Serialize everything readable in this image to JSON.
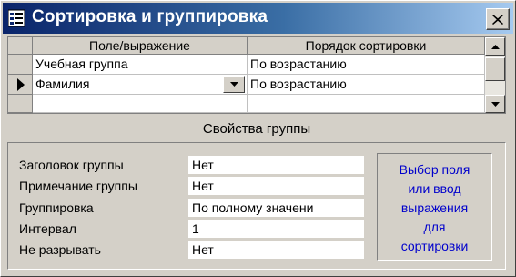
{
  "window": {
    "title": "Сортировка и группировка"
  },
  "grid": {
    "columns": [
      "Поле/выражение",
      "Порядок сортировки"
    ],
    "rows": [
      {
        "field": "Учебная группа",
        "order": "По возрастанию"
      },
      {
        "field": "Фамилия",
        "order": "По возрастанию"
      },
      {
        "field": "",
        "order": ""
      }
    ],
    "current_row": 1
  },
  "group_properties": {
    "title": "Свойства группы",
    "items": [
      {
        "label": "Заголовок группы",
        "value": "Нет"
      },
      {
        "label": "Примечание группы",
        "value": "Нет"
      },
      {
        "label": "Группировка",
        "value": "По полному значени"
      },
      {
        "label": "Интервал",
        "value": "1"
      },
      {
        "label": "Не разрывать",
        "value": "Нет"
      }
    ],
    "hint": [
      "Выбор поля",
      "или ввод",
      "выражения",
      "для",
      "сортировки"
    ]
  },
  "icons": {
    "app": "sorting-grouping-icon",
    "close": "close-icon",
    "row_selector": "current-row-arrow-icon",
    "dropdown": "chevron-down-icon",
    "scroll_up": "scroll-up-arrow-icon",
    "scroll_down": "scroll-down-arrow-icon"
  },
  "colors": {
    "titlebar_start": "#0a246a",
    "titlebar_end": "#a6caf0",
    "face": "#d4d0c8",
    "hint_text": "#0000cc"
  }
}
